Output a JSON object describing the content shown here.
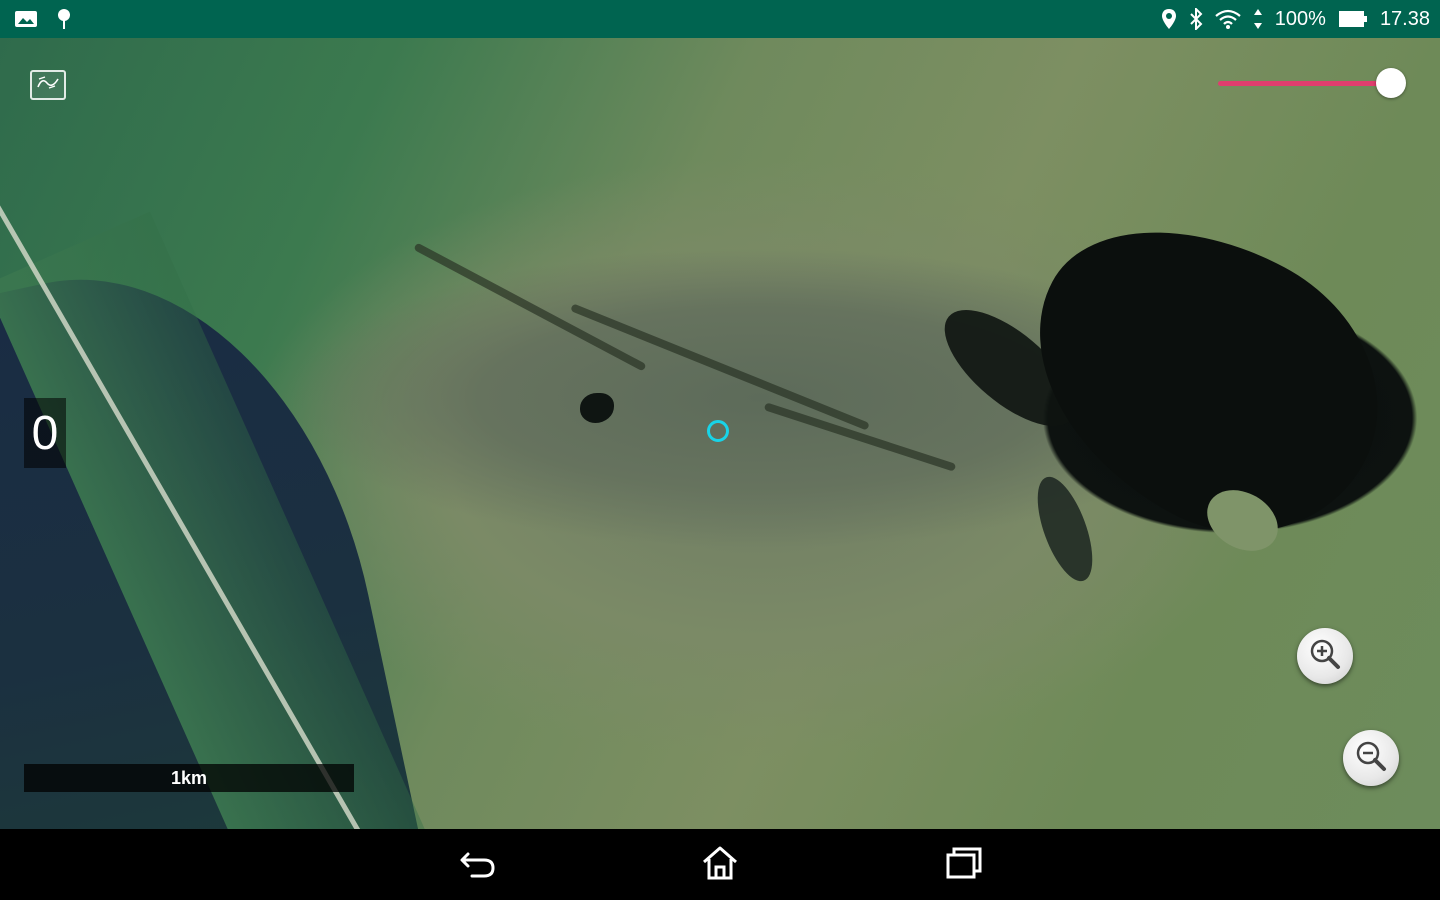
{
  "status_bar": {
    "left_icons": [
      "gallery-icon",
      "pin-notification-icon"
    ],
    "right_icons": [
      "location-icon",
      "bluetooth-icon",
      "wifi-icon",
      "data-arrows-icon",
      "battery-icon"
    ],
    "battery": "100%",
    "time": "17.38",
    "background_color": "#006450"
  },
  "map": {
    "layers_icon": "map-layers-icon",
    "opacity_slider": {
      "value_fraction": 0.97,
      "track_color": "#e03d6e"
    },
    "counter": "0",
    "scale_label": "1km",
    "marker_color": "#18d4e8",
    "zoom_in_icon": "zoom-in-icon",
    "zoom_out_icon": "zoom-out-icon"
  },
  "nav_bar": {
    "icons": [
      "back-icon",
      "home-icon",
      "recent-apps-icon"
    ]
  }
}
